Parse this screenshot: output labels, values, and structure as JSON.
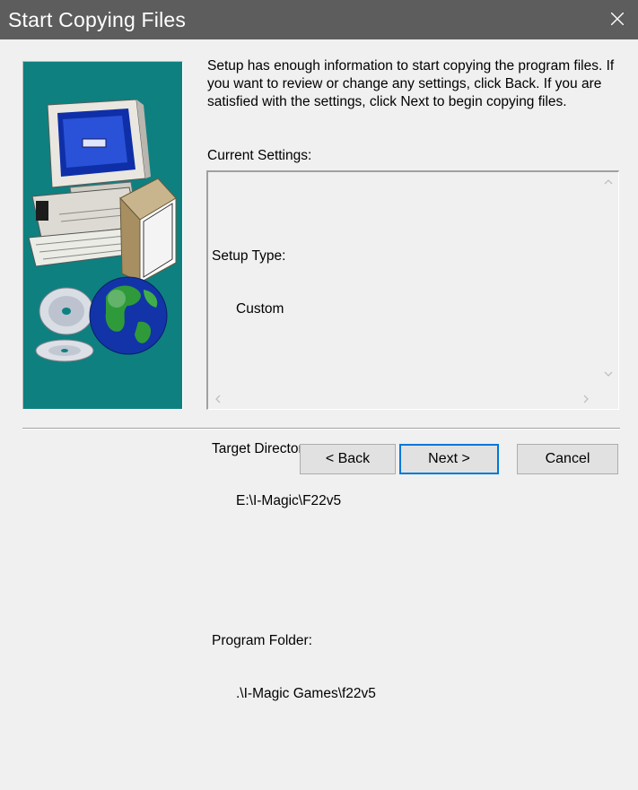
{
  "window": {
    "title": "Start Copying Files"
  },
  "intro_text": "Setup has enough information to start copying the program files. If you want to review or change any settings, click Back.  If you are satisfied with the settings, click Next to begin copying files.",
  "current_settings_label": "Current Settings:",
  "settings": [
    {
      "label": "Setup Type:",
      "value": "Custom"
    },
    {
      "label": "Target Directory:",
      "value": "E:\\I-Magic\\F22v5"
    },
    {
      "label": "Program Folder:",
      "value": ".\\I-Magic Games\\f22v5"
    }
  ],
  "buttons": {
    "back": "< Back",
    "next": "Next >",
    "cancel": "Cancel"
  },
  "colors": {
    "titlebar": "#5d5d5d",
    "art_background": "#0e8080",
    "default_button_border": "#0078d7"
  },
  "icons": [
    "close-icon",
    "computer-illustration",
    "cd-disc-illustration",
    "globe-illustration"
  ]
}
